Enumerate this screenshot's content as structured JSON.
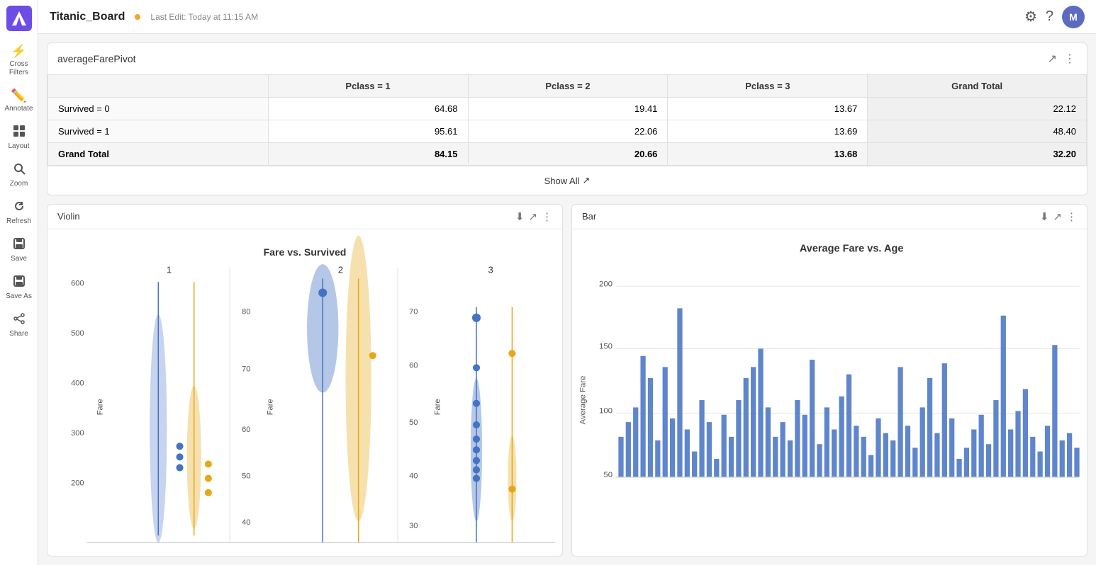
{
  "app": {
    "title": "Titanic_Board",
    "last_edit": "Last Edit: Today at 11:15 AM",
    "avatar_initial": "M"
  },
  "sidebar": {
    "items": [
      {
        "id": "cross-filters",
        "label": "Cross\nFilters",
        "icon": "⚡"
      },
      {
        "id": "annotate",
        "label": "Annotate",
        "icon": "✏️"
      },
      {
        "id": "layout",
        "label": "Layout",
        "icon": "⊞"
      },
      {
        "id": "zoom",
        "label": "Zoom",
        "icon": "🔍"
      },
      {
        "id": "refresh",
        "label": "Refresh",
        "icon": "↻"
      },
      {
        "id": "save",
        "label": "Save",
        "icon": "💾"
      },
      {
        "id": "save-as",
        "label": "Save As",
        "icon": "📋"
      },
      {
        "id": "share",
        "label": "Share",
        "icon": "⬆"
      }
    ]
  },
  "pivot": {
    "title": "averageFarePivot",
    "headers": [
      "",
      "Pclass = 1",
      "Pclass = 2",
      "Pclass = 3",
      "Grand Total"
    ],
    "rows": [
      {
        "label": "Survived = 0",
        "pclass1": "64.68",
        "pclass2": "19.41",
        "pclass3": "13.67",
        "grand": "22.12"
      },
      {
        "label": "Survived = 1",
        "pclass1": "95.61",
        "pclass2": "22.06",
        "pclass3": "13.69",
        "grand": "48.40"
      },
      {
        "label": "Grand Total",
        "pclass1": "84.15",
        "pclass2": "20.66",
        "pclass3": "13.68",
        "grand": "32.20"
      }
    ],
    "show_all_label": "Show All"
  },
  "violin_chart": {
    "panel_label": "Violin",
    "title": "Fare vs. Survived"
  },
  "bar_chart": {
    "panel_label": "Bar",
    "title": "Average Fare vs. Age",
    "y_label": "Average Fare"
  },
  "icons": {
    "external_link": "↗",
    "more_vert": "⋮",
    "download": "⬇",
    "settings": "⚙",
    "help": "?"
  }
}
